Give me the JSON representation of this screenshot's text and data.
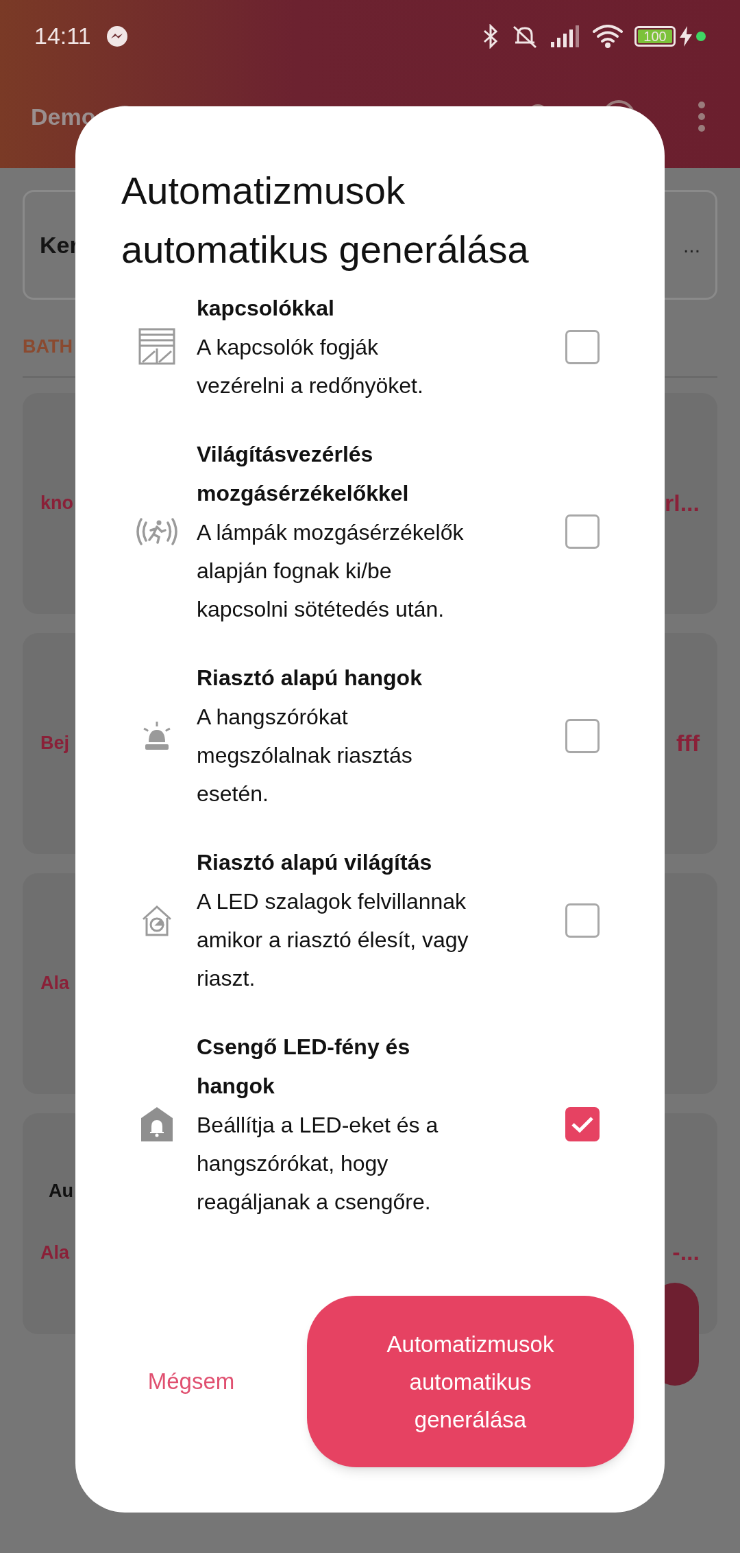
{
  "status_bar": {
    "time": "14:11",
    "battery": "100"
  },
  "app_bar": {
    "title": "Demo"
  },
  "search": {
    "value": "Ker",
    "trailing": "..."
  },
  "section": {
    "title": "BATH"
  },
  "cards": [
    {
      "primary": "kno",
      "secondary": "rl..."
    },
    {
      "primary": "Bej",
      "secondary": "fff"
    },
    {
      "primary": "Ala"
    },
    {
      "heading": "Au",
      "primary": "Ala",
      "secondary": "-..."
    }
  ],
  "dialog": {
    "title": "Automatizmusok automatikus generálása",
    "items": [
      {
        "kind": "blinds",
        "title": "kapcsolókkal",
        "description": "A kapcsolók fogják vezérelni a redőnyöket.",
        "checked": false
      },
      {
        "kind": "motion",
        "title": "Világításvezérlés mozgásérzékelőkkel",
        "description": "A lámpák mozgásérzékelők alapján fognak ki/be kapcsolni sötétedés után.",
        "checked": false
      },
      {
        "kind": "siren",
        "title": "Riasztó alapú hangok",
        "description": "A hangszórókat megszólalnak riasztás esetén.",
        "checked": false
      },
      {
        "kind": "alarm_house",
        "title": "Riasztó alapú világítás",
        "description": "A LED szalagok felvillannak amikor a riasztó élesít, vagy riaszt.",
        "checked": false
      },
      {
        "kind": "bell_house",
        "title": "Csengő LED-fény és hangok",
        "description": "Beállítja a LED-eket és a hangszórókat, hogy reagáljanak a csengőre.",
        "checked": true
      }
    ],
    "cancel": "Mégsem",
    "confirm": "Automatizmusok automatikus generálása"
  }
}
